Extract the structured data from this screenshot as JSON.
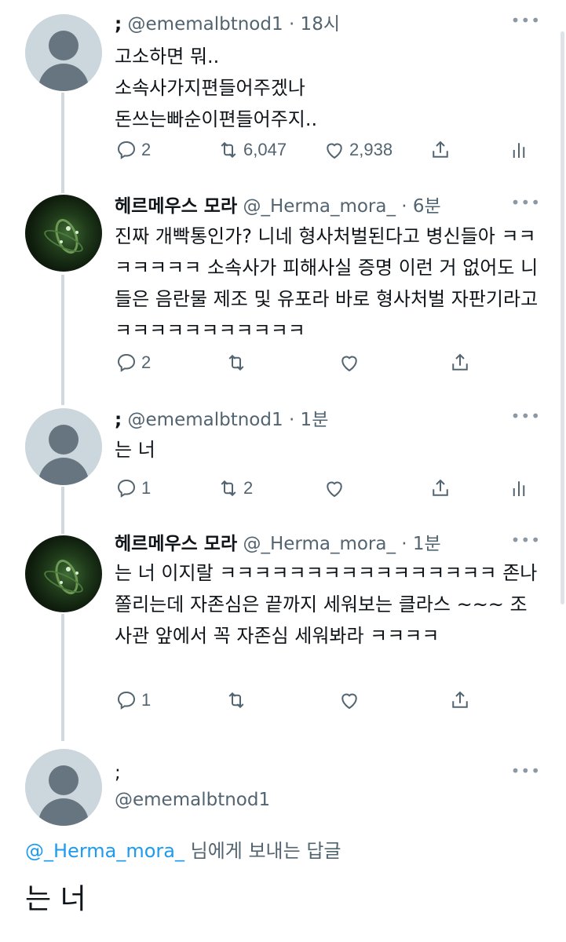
{
  "tweets": [
    {
      "name": ";",
      "handle": "@ememalbtnod1",
      "time": "· 18시",
      "text": "고소하면 뭐..\n소속사가지편들어주겠나\n돈쓰는빠순이편들어주지..",
      "reply_count": "2",
      "retweet_count": "6,047",
      "like_count": "2,938",
      "avatar": "default-avatar"
    },
    {
      "name": "헤르메우스 모라",
      "handle": "@_Herma_mora_",
      "time": "· 6분",
      "text": "진짜 개빡통인가? 니네 형사처벌된다고 병신들아 ㅋㅋㅋㅋㅋㅋㅋ 소속사가 피해사실 증명 이런 거 없어도 니들은 음란물 제조 및 유포라 바로 형사처벌 자판기라고 ㅋㅋㅋㅋㅋㅋㅋㅋㅋㅋㅋ",
      "reply_count": "2",
      "retweet_count": "",
      "like_count": "",
      "avatar": "dark-tentacle-avatar"
    },
    {
      "name": ";",
      "handle": "@ememalbtnod1",
      "time": "· 1분",
      "text": "는 너",
      "reply_count": "1",
      "retweet_count": "2",
      "like_count": "",
      "avatar": "default-avatar"
    },
    {
      "name": "헤르메우스 모라",
      "handle": "@_Herma_mora_",
      "time": "· 1분",
      "text": "는 너 이지랄 ㅋㅋㅋㅋㅋㅋㅋㅋㅋㅋㅋㅋㅋㅋㅋㅋ 존나 쫄리는데 자존심은 끝까지 세워보는 클라스 ~~~ 조사관 앞에서 꼭 자존심 세워봐라 ㅋㅋㅋㅋ",
      "reply_count": "1",
      "retweet_count": "",
      "like_count": "",
      "avatar": "dark-tentacle-avatar"
    }
  ],
  "focused": {
    "name": ";",
    "handle": "@ememalbtnod1",
    "reply_to_mention": "@_Herma_mora_",
    "reply_to_suffix": " 님에게 보내는 답글",
    "text": "는 너"
  },
  "icons": {
    "reply": "reply-icon",
    "retweet": "retweet-icon",
    "like": "heart-icon",
    "share": "share-icon",
    "analytics": "analytics-icon",
    "more": "more-icon"
  },
  "colors": {
    "text": "#0f1419",
    "secondary": "#536471",
    "link": "#1d9bf0",
    "thread_line": "#cfd9de"
  }
}
